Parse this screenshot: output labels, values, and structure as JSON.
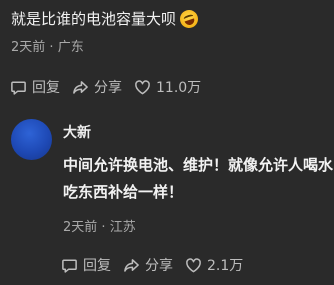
{
  "comment": {
    "text": "就是比谁的电池容量大呗",
    "emoji": "rolling-on-floor-laughing",
    "time": "2天前",
    "location": "广东",
    "actions": {
      "reply": "回复",
      "share": "分享",
      "likes": "11.0万"
    }
  },
  "reply": {
    "username": "大新",
    "text": "中间允许换电池、维护！就像允许人喝水吃东西补给一样！",
    "time": "2天前",
    "location": "江苏",
    "actions": {
      "reply": "回复",
      "share": "分享",
      "likes": "2.1万"
    }
  },
  "separator": " · ",
  "colors": {
    "background": "#2a2a2a",
    "text": "#f2f2f2",
    "meta": "#a9a9a9",
    "avatar": "#1e49b5"
  }
}
